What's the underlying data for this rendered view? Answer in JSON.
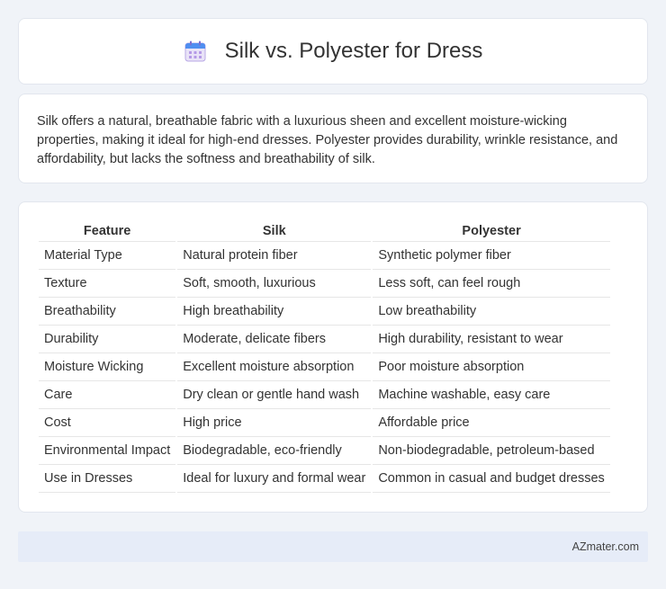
{
  "header": {
    "title": "Silk vs. Polyester for Dress",
    "icon": "calendar-icon"
  },
  "intro": {
    "text": "Silk offers a natural, breathable fabric with a luxurious sheen and excellent moisture-wicking properties, making it ideal for high-end dresses. Polyester provides durability, wrinkle resistance, and affordability, but lacks the softness and breathability of silk."
  },
  "table": {
    "headers": [
      "Feature",
      "Silk",
      "Polyester"
    ],
    "rows": [
      [
        "Material Type",
        "Natural protein fiber",
        "Synthetic polymer fiber"
      ],
      [
        "Texture",
        "Soft, smooth, luxurious",
        "Less soft, can feel rough"
      ],
      [
        "Breathability",
        "High breathability",
        "Low breathability"
      ],
      [
        "Durability",
        "Moderate, delicate fibers",
        "High durability, resistant to wear"
      ],
      [
        "Moisture Wicking",
        "Excellent moisture absorption",
        "Poor moisture absorption"
      ],
      [
        "Care",
        "Dry clean or gentle hand wash",
        "Machine washable, easy care"
      ],
      [
        "Cost",
        "High price",
        "Affordable price"
      ],
      [
        "Environmental Impact",
        "Biodegradable, eco-friendly",
        "Non-biodegradable, petroleum-based"
      ],
      [
        "Use in Dresses",
        "Ideal for luxury and formal wear",
        "Common in casual and budget dresses"
      ]
    ]
  },
  "footer": {
    "brand": "AZmater.com"
  }
}
